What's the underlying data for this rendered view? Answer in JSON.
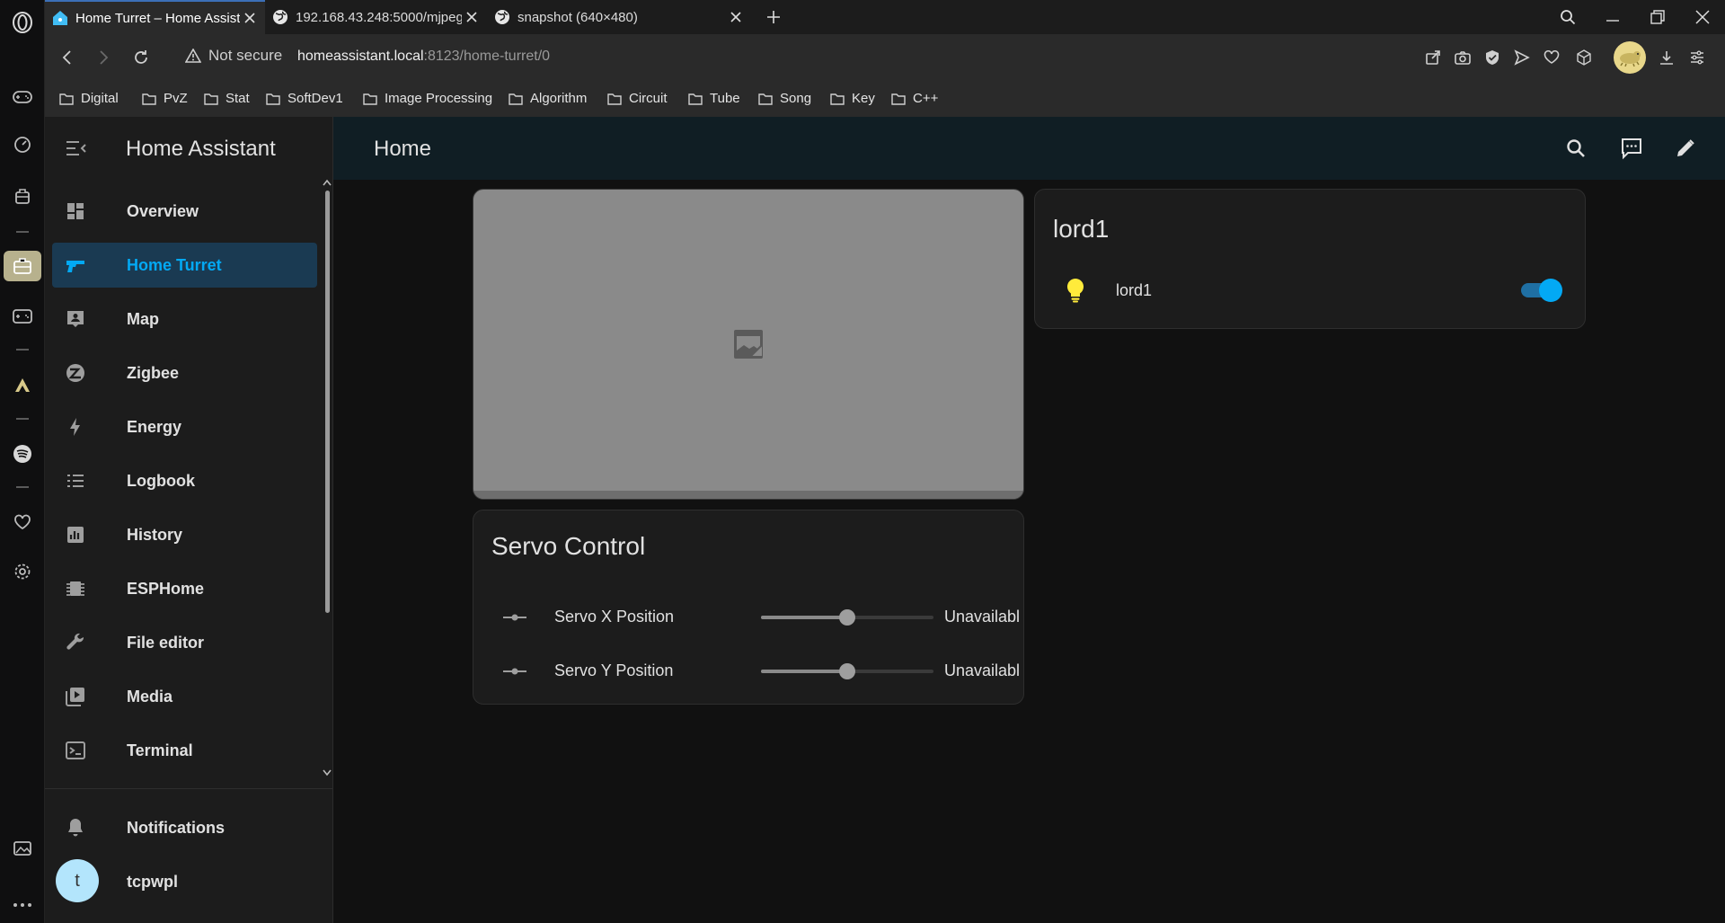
{
  "browser": {
    "tabs": [
      {
        "label": "Home Turret – Home Assistant",
        "favicon": "home-assistant-icon",
        "active": true
      },
      {
        "label": "192.168.43.248:5000/mjpeg",
        "favicon": "globe-icon",
        "active": false
      },
      {
        "label": "snapshot (640×480)",
        "favicon": "globe-icon",
        "active": false
      }
    ],
    "security_label": "Not secure",
    "url_host": "homeassistant.local",
    "url_rest": ":8123/home-turret/0",
    "bookmarks": [
      "Digital",
      "PvZ",
      "Stat",
      "SoftDev1",
      "Image Processing",
      "Algorithm",
      "Circuit",
      "Tube",
      "Song",
      "Key",
      "C++"
    ]
  },
  "sidebar": {
    "title": "Home Assistant",
    "items": [
      {
        "label": "Overview",
        "icon": "dashboard-icon"
      },
      {
        "label": "Home Turret",
        "icon": "pistol-icon",
        "selected": true
      },
      {
        "label": "Map",
        "icon": "map-icon"
      },
      {
        "label": "Zigbee",
        "icon": "zigbee-icon"
      },
      {
        "label": "Energy",
        "icon": "lightning-bolt-icon"
      },
      {
        "label": "Logbook",
        "icon": "format-list-icon"
      },
      {
        "label": "History",
        "icon": "chart-box-icon"
      },
      {
        "label": "ESPHome",
        "icon": "chip-icon"
      },
      {
        "label": "File editor",
        "icon": "wrench-icon"
      },
      {
        "label": "Media",
        "icon": "play-box-multiple-icon"
      },
      {
        "label": "Terminal",
        "icon": "console-icon"
      }
    ],
    "notifications_label": "Notifications",
    "user": {
      "initial": "t",
      "name": "tcpwpl"
    }
  },
  "header": {
    "title": "Home"
  },
  "servo_card": {
    "title": "Servo Control",
    "rows": [
      {
        "label": "Servo X Position",
        "value": "Unavailable",
        "slider": 0.5
      },
      {
        "label": "Servo Y Position",
        "value": "Unavailable",
        "slider": 0.5
      }
    ]
  },
  "light_card": {
    "title": "lord1",
    "entity_label": "lord1",
    "state_on": true,
    "bulb_color": "#ffeb3b"
  },
  "colors": {
    "accent": "#03a9f4",
    "selected_bg": "#1a3a52"
  }
}
